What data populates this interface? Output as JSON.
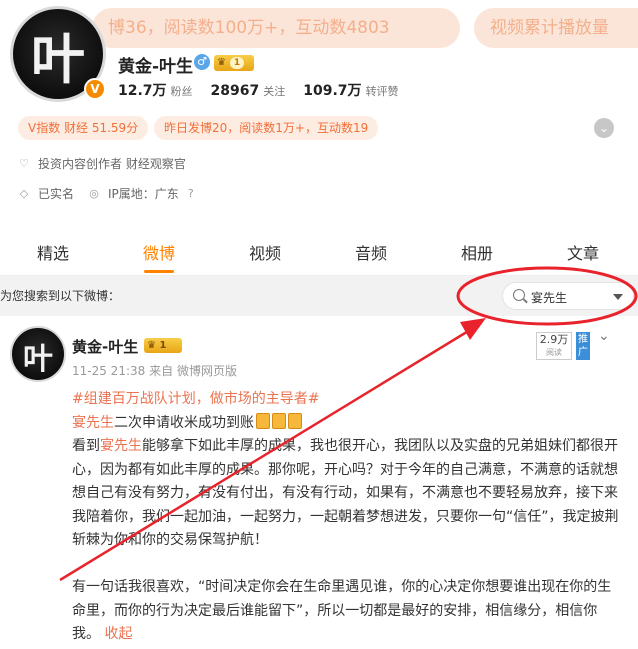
{
  "banner": {
    "pill1": "博36，阅读数100万+，互动数4803",
    "pill2": "视频累计播放量"
  },
  "profile": {
    "avatar_char": "叶",
    "verified_mark": "V",
    "name": "黄金-叶生",
    "gender_icon": "♂",
    "level": "1",
    "stats": [
      {
        "num": "12.7万",
        "label": "粉丝"
      },
      {
        "num": "28967",
        "label": "关注"
      },
      {
        "num": "109.7万",
        "label": "转评赞"
      }
    ],
    "tag_index": "V指数 财经 51.59分",
    "tag_yesterday": "昨日发博20，阅读数1万+，互动数19",
    "info_line1": "投资内容创作者 财经观察官",
    "info_real_name": "已实名",
    "info_ip": "IP属地：广东"
  },
  "tabs": [
    "精选",
    "微博",
    "视频",
    "音频",
    "相册",
    "文章"
  ],
  "active_tab_index": 1,
  "search": {
    "hint": "为您搜索到以下微博：",
    "value": "宴先生"
  },
  "post": {
    "avatar_char": "叶",
    "author": "黄金-叶生",
    "level": "1",
    "time": "11-25 21:38",
    "source_prefix": "来自",
    "source": "微博网页版",
    "views": "2.9万",
    "views_label": "阅读",
    "promote": "推广",
    "topic": "#组建百万战队计划，做市场的主导者#",
    "line2_name": "宴先生",
    "line2_rest": "二次申请收米成功到账",
    "para1_prefix": "看到",
    "para1_name": "宴先生",
    "para1_rest": "能够拿下如此丰厚的成果，我也很开心，我团队以及实盘的兄弟姐妹们都很开心，因为都有如此丰厚的成果。那你呢，开心吗？对于今年的自己满意，不满意的话就想想自己有没有努力，有没有付出，有没有行动，如果有，不满意也不要轻易放弃，接下来我陪着你，我们一起加油，一起努力，一起朝着梦想进发，只要你一句“信任”，我定披荆斩棘为你和你的交易保驾护航！",
    "para2": "有一句话我很喜欢，“时间决定你会在生命里遇见谁，你的心决定你想要谁出现在你的生命里，而你的行为决定最后谁能留下”，所以一切都是最好的安排，相信缘分，相信你我。",
    "collapse": "收起"
  },
  "colors": {
    "accent": "#ff8200",
    "highlight": "#eb7350",
    "annotation": "#e8232b"
  }
}
